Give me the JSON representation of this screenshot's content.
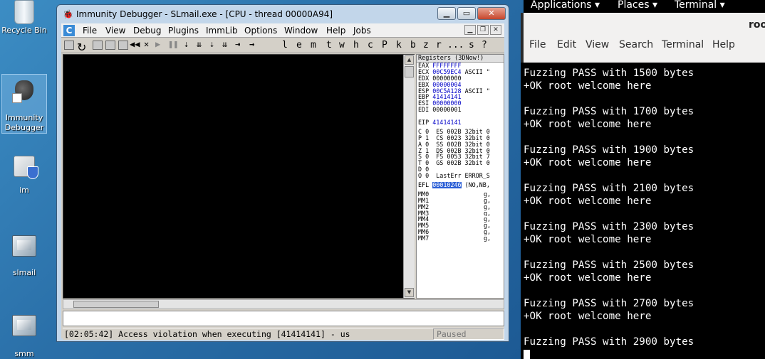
{
  "desktop": {
    "icons": [
      {
        "label": "Recycle Bin",
        "icon": "recycle-bin-icon"
      },
      {
        "label": "Immunity Debugger",
        "icon": "immunity-debugger-icon"
      },
      {
        "label": "im",
        "icon": "installer-package-icon"
      },
      {
        "label": "slmail",
        "icon": "slmail-icon"
      },
      {
        "label": "smm",
        "icon": "slmail-icon"
      }
    ]
  },
  "immunity": {
    "title": "Immunity Debugger - SLmail.exe - [CPU - thread 00000A94]",
    "menu": [
      "File",
      "View",
      "Debug",
      "Plugins",
      "ImmLib",
      "Options",
      "Window",
      "Help",
      "Jobs"
    ],
    "toolbar_letters": [
      "l",
      "e",
      "m",
      "t",
      "w",
      "h",
      "c",
      "P",
      "k",
      "b",
      "z",
      "r",
      "...",
      "s",
      "?"
    ],
    "registers_header": "Registers (3DNow!)",
    "registers": [
      {
        "name": "EAX",
        "value": "FFFFFFFF",
        "extra": "",
        "color": "blue"
      },
      {
        "name": "ECX",
        "value": "00C59EC4",
        "extra": "ASCII \"",
        "color": "blue"
      },
      {
        "name": "EDX",
        "value": "00000000",
        "extra": "",
        "color": "black"
      },
      {
        "name": "EBX",
        "value": "00000004",
        "extra": "",
        "color": "blue"
      },
      {
        "name": "ESP",
        "value": "00C5A128",
        "extra": "ASCII \"",
        "color": "blue"
      },
      {
        "name": "EBP",
        "value": "41414141",
        "extra": "",
        "color": "blue"
      },
      {
        "name": "ESI",
        "value": "00000000",
        "extra": "",
        "color": "blue"
      },
      {
        "name": "EDI",
        "value": "00000001",
        "extra": "",
        "color": "black"
      },
      {
        "name": "",
        "value": "",
        "extra": "",
        "color": "black"
      },
      {
        "name": "EIP",
        "value": "41414141",
        "extra": "",
        "color": "blue"
      }
    ],
    "flags": [
      "C 0  ES 002B 32bit 0",
      "P 1  CS 0023 32bit 0",
      "A 0  SS 002B 32bit 0",
      "Z 1  DS 002B 32bit 0",
      "S 0  FS 0053 32bit 7",
      "T 0  GS 002B 32bit 0",
      "D 0",
      "O 0  LastErr ERROR_S"
    ],
    "efl": {
      "label": "EFL",
      "value": "00010246",
      "extra": "(NO,NB,"
    },
    "mmx": [
      {
        "name": "MM0",
        "value": "g,"
      },
      {
        "name": "MM1",
        "value": "g,"
      },
      {
        "name": "MM2",
        "value": "g,"
      },
      {
        "name": "MM3",
        "value": "g,"
      },
      {
        "name": "MM4",
        "value": "g,"
      },
      {
        "name": "MM5",
        "value": "g,"
      },
      {
        "name": "MM6",
        "value": "g,"
      },
      {
        "name": "MM7",
        "value": "g,"
      }
    ],
    "status_message": "[02:05:42] Access violation when executing [41414141] - us",
    "status_state": "Paused"
  },
  "kali": {
    "panel": [
      "Applications ▾",
      "Places ▾",
      "Terminal ▾"
    ],
    "terminal_title": "root",
    "terminal_menu": [
      "File",
      "Edit",
      "View",
      "Search",
      "Terminal",
      "Help"
    ],
    "lines": [
      "Fuzzing PASS with 1500 bytes",
      "+OK root welcome here",
      "",
      "Fuzzing PASS with 1700 bytes",
      "+OK root welcome here",
      "",
      "Fuzzing PASS with 1900 bytes",
      "+OK root welcome here",
      "",
      "Fuzzing PASS with 2100 bytes",
      "+OK root welcome here",
      "",
      "Fuzzing PASS with 2300 bytes",
      "+OK root welcome here",
      "",
      "Fuzzing PASS with 2500 bytes",
      "+OK root welcome here",
      "",
      "Fuzzing PASS with 2700 bytes",
      "+OK root welcome here",
      "",
      "Fuzzing PASS with 2900 bytes"
    ]
  }
}
